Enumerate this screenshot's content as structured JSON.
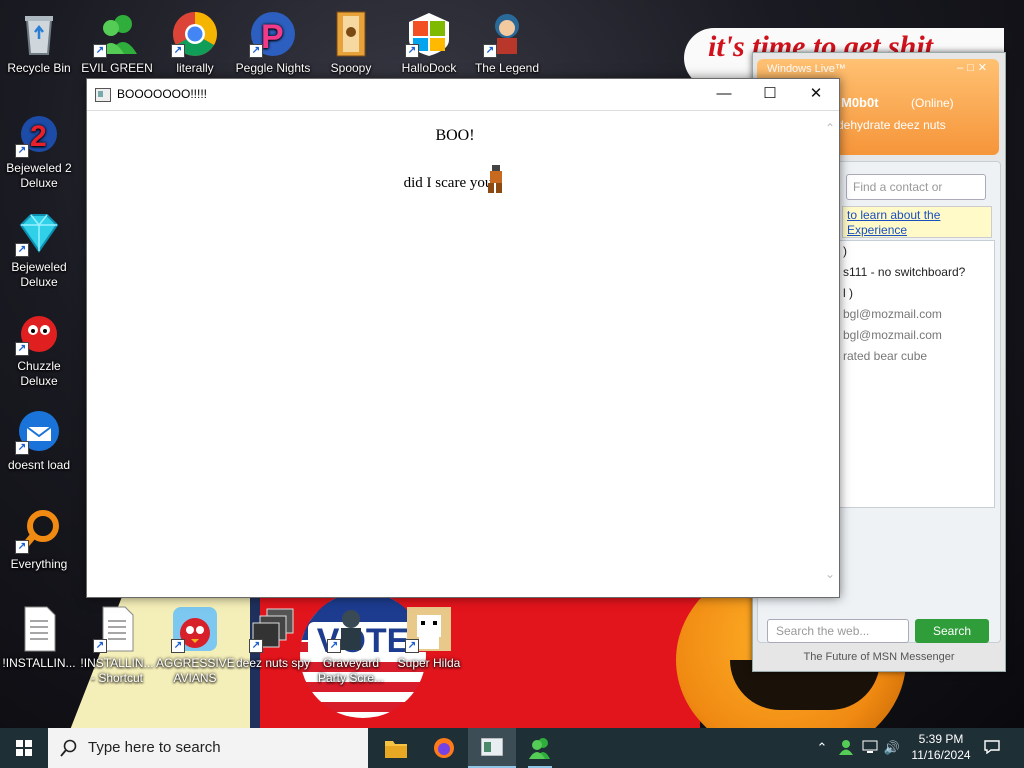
{
  "wallpaper": {
    "banner_text": "it's time to get shit",
    "vote_text": "VOTE"
  },
  "desktop_icons": [
    {
      "name": "recycle-bin",
      "label": "Recycle Bin"
    },
    {
      "name": "evil-green-msn",
      "label": "EVIL GREEN\nMSN CO..."
    },
    {
      "name": "literally",
      "label": "literally\n..."
    },
    {
      "name": "peggle-nights",
      "label": "Peggle Nights\nDel..."
    },
    {
      "name": "spoopy",
      "label": "Spoopy"
    },
    {
      "name": "hallodock",
      "label": "HalloDock"
    },
    {
      "name": "the-legend",
      "label": "The Legend\nof Tilda"
    },
    {
      "name": "bejeweled-2",
      "label": "Bejeweled 2\nDeluxe"
    },
    {
      "name": "bejeweled",
      "label": "Bejeweled\nDeluxe"
    },
    {
      "name": "chuzzle",
      "label": "Chuzzle\nDeluxe"
    },
    {
      "name": "doesnt-load",
      "label": "doesnt load"
    },
    {
      "name": "everything",
      "label": "Everything"
    },
    {
      "name": "installin-1",
      "label": "!INSTALLIN..."
    },
    {
      "name": "installin-2",
      "label": "!INSTALLIN...\n- Shortcut"
    },
    {
      "name": "aggressive-avians",
      "label": "AGGRESSIVE\nAVIANS"
    },
    {
      "name": "deez-nuts-spy",
      "label": "deez nuts spy"
    },
    {
      "name": "graveyard-party",
      "label": "Graveyard\nParty Scre..."
    },
    {
      "name": "super-hilda",
      "label": "Super Hilda"
    }
  ],
  "msn": {
    "titlebar": "Windows Live™",
    "username": "M0b0t",
    "status": "(Online)",
    "personal_message": "dehydrate deez nuts",
    "search_contact_placeholder": "Find a contact or number...",
    "notice_line1": "to learn about the",
    "notice_line2": "Experience",
    "contacts": [
      ")",
      "s111 - no switchboard?",
      "l )",
      "bgl@mozmail.com",
      "bgl@mozmail.com",
      "rated bear cube"
    ],
    "web_search_placeholder": "Search the web...",
    "search_button": "Search",
    "footer": "The Future of MSN Messenger"
  },
  "boo_window": {
    "title": "BOOOOOOO!!!!!",
    "heading": "BOO!",
    "body_text": "did I scare you"
  },
  "taskbar": {
    "search_placeholder": "Type here to search",
    "time": "5:39 PM",
    "date": "11/16/2024"
  }
}
